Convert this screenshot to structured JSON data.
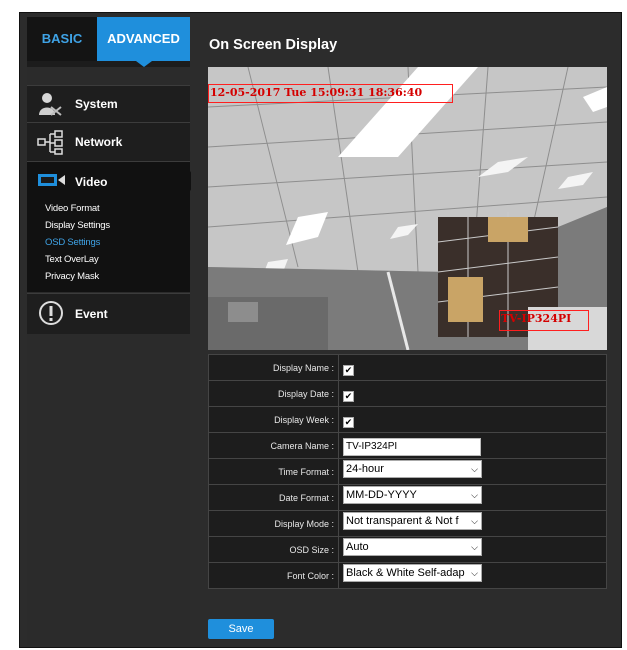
{
  "tabs": {
    "basic": "BASIC",
    "advanced": "ADVANCED"
  },
  "menu": {
    "system": "System",
    "network": "Network",
    "video": "Video",
    "video_items": [
      "Video Format",
      "Display Settings",
      "OSD Settings",
      "Text OverLay",
      "Privacy Mask"
    ],
    "active_item": "OSD Settings",
    "event": "Event"
  },
  "page_title": "On Screen Display",
  "preview": {
    "osd_datetime": "12-05-2017 Tue 15:09:31 18:36:40",
    "osd_camera_name": "TV-IP324PI"
  },
  "settings": {
    "display_name_label": "Display Name :",
    "display_date_label": "Display Date :",
    "display_week_label": "Display Week :",
    "camera_name_label": "Camera Name :",
    "camera_name_value": "TV-IP324PI",
    "time_format_label": "Time Format :",
    "time_format_value": "24-hour",
    "date_format_label": "Date Format :",
    "date_format_value": "MM-DD-YYYY",
    "display_mode_label": "Display Mode :",
    "display_mode_value": "Not transparent & Not f",
    "osd_size_label": "OSD Size :",
    "osd_size_value": "Auto",
    "font_color_label": "Font Color :",
    "font_color_value": "Black & White Self-adap"
  },
  "save_label": "Save",
  "colors": {
    "accent": "#1f8fdc",
    "osd_red": "#ff1f1f",
    "active_link": "#3fa3e6"
  }
}
